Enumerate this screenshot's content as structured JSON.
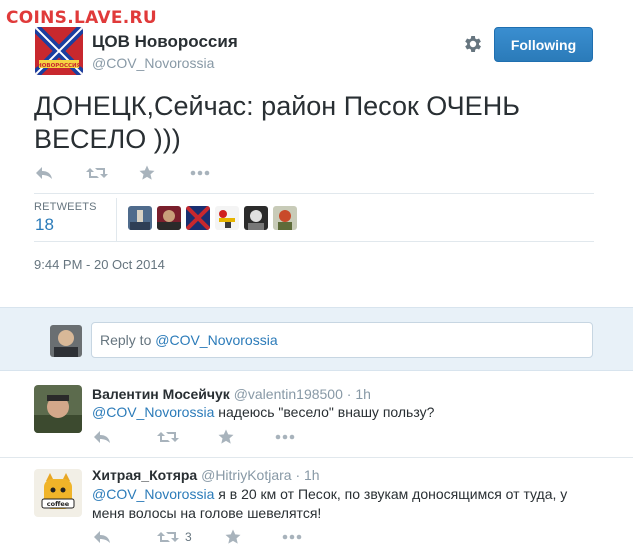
{
  "watermark": "COINS.LAVE.RU",
  "tweet": {
    "author_name": "ЦОВ Новороссия",
    "author_handle": "@COV_Novorossia",
    "follow_label": "Following",
    "text": "ДОНЕЦК,Сейчас: район Песок ОЧЕНЬ ВЕСЕЛО )))",
    "retweets_label": "RETWEETS",
    "retweets_count": "18",
    "timestamp": "9:44 PM - 20 Oct 2014",
    "avatar_flag_text": "НОВОРОССИЯ",
    "icons": [
      "reply-icon",
      "retweet-icon",
      "favorite-icon",
      "more-icon",
      "gear-icon"
    ]
  },
  "compose": {
    "prefix": "Reply to ",
    "mention": "@COV_Novorossia"
  },
  "replies": [
    {
      "name": "Валентин Мосейчук",
      "handle": "@valentin198500",
      "time": "· 1h",
      "mention": "@COV_Novorossia",
      "text": " надеюсь \"весело\" внашу пользу?",
      "retweet_count": ""
    },
    {
      "name": "Хитрая_Котяра",
      "handle": "@HitriyKotjara",
      "time": "· 1h",
      "mention": "@COV_Novorossia",
      "text": " я в 20 км от Песок, по звукам доносящимся от туда, у меня волосы на голове шевелятся!",
      "retweet_count": "3",
      "avatar_text": "coffee"
    }
  ],
  "colors": {
    "accent": "#2b7bb9",
    "watermark": "#e03a3a",
    "muted": "#8899a6",
    "reply_bg": "#e8f1f8"
  }
}
